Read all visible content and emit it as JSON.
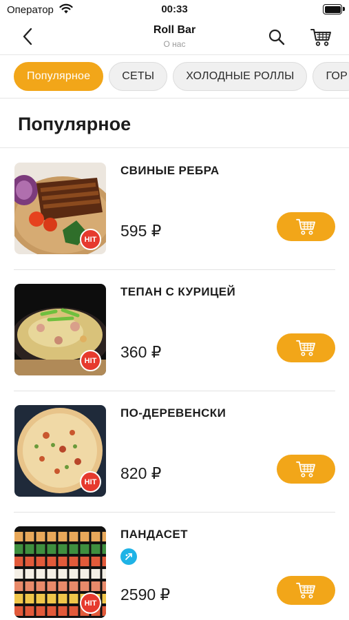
{
  "status_bar": {
    "carrier": "Оператор",
    "time": "00:33"
  },
  "navbar": {
    "title": "Roll Bar",
    "subtitle": "О нас"
  },
  "tabs": [
    {
      "label": "Популярное",
      "active": true
    },
    {
      "label": "СЕТЫ",
      "active": false
    },
    {
      "label": "ХОЛОДНЫЕ РОЛЛЫ",
      "active": false
    },
    {
      "label": "ГОР",
      "active": false
    }
  ],
  "section": {
    "title": "Популярное"
  },
  "products": [
    {
      "name": "СВИНЫЕ РЕБРА",
      "price": "595 ₽",
      "badge": "HIT"
    },
    {
      "name": "ТЕПАН С КУРИЦЕЙ",
      "price": "360 ₽",
      "badge": "HIT"
    },
    {
      "name": "ПО-ДЕРЕВЕНСКИ",
      "price": "820 ₽",
      "badge": "HIT"
    },
    {
      "name": "ПАНДАСЕТ",
      "price": "2590 ₽",
      "badge": "HIT"
    }
  ],
  "colors": {
    "accent": "#f2a619",
    "badge": "#e63a2e",
    "tag": "#1fb3e6"
  },
  "icons": {
    "back": "chevron-left-icon",
    "search": "search-icon",
    "cart": "cart-icon",
    "tag": "panda-tag-icon"
  }
}
